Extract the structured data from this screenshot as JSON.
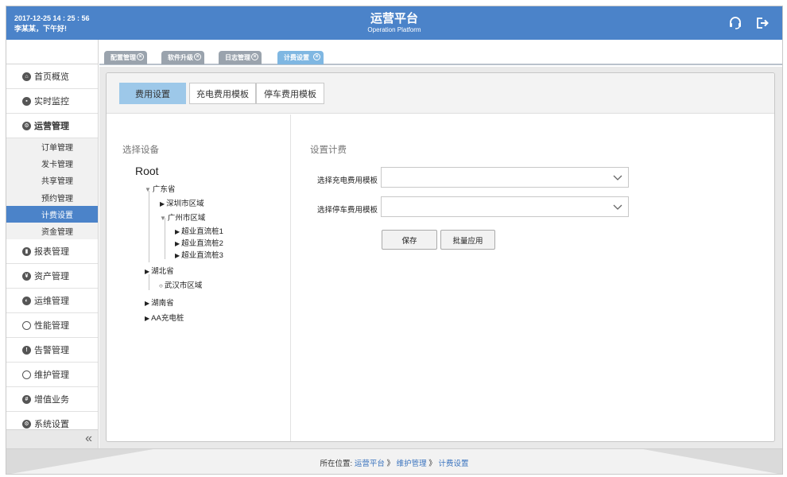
{
  "header": {
    "datetime": "2017-12-25 14 : 25 : 56",
    "greeting": "李某某，下午好!",
    "title": "运营平台",
    "subtitle": "Operation Platform",
    "icons": [
      "headset-icon",
      "logout-icon"
    ]
  },
  "sidebar": {
    "items": [
      {
        "label": "首页概览",
        "icon": "home-icon"
      },
      {
        "label": "实时监控",
        "icon": "monitor-icon"
      },
      {
        "label": "运营管理",
        "icon": "settings-icon"
      },
      {
        "label": "报表管理",
        "icon": "report-icon"
      },
      {
        "label": "资产管理",
        "icon": "asset-icon"
      },
      {
        "label": "运维管理",
        "icon": "ops-icon"
      },
      {
        "label": "性能管理",
        "icon": "gauge-icon"
      },
      {
        "label": "告警管理",
        "icon": "alert-icon"
      },
      {
        "label": "维护管理",
        "icon": "maintenance-icon"
      },
      {
        "label": "增值业务",
        "icon": "value-added-icon"
      },
      {
        "label": "系统设置",
        "icon": "system-icon"
      }
    ],
    "subitems": [
      "订单管理",
      "发卡管理",
      "共享管理",
      "预约管理",
      "计费设置",
      "资金管理"
    ],
    "collapse_label": "«"
  },
  "tabs": [
    "配置管理",
    "软件升级",
    "日志管理",
    "计费设置"
  ],
  "panel": {
    "buttons": [
      "费用设置",
      "充电费用模板",
      "停车费用模板"
    ],
    "left_title": "选择设备",
    "tree": {
      "root": "Root",
      "nodes": [
        "广东省",
        "深圳市区域",
        "广州市区域",
        "超业直流桩1",
        "超业直流桩2",
        "超业直流桩3",
        "湖北省",
        "武汉市区域",
        "湖南省",
        "AA充电桩"
      ]
    },
    "right_title": "设置计费",
    "form": {
      "charge_label": "选择充电费用模板",
      "charge_value": "",
      "parking_label": "选择停车费用模板",
      "parking_value": "",
      "save": "保存",
      "batch_apply": "批量应用"
    }
  },
  "footer": {
    "prefix": "所在位置:",
    "crumbs": [
      "运营平台",
      "维护管理",
      "计费设置"
    ],
    "separator": "》"
  },
  "colors": {
    "header_blue": "#4b83c9",
    "active_tab": "#7fb7e2",
    "active_button": "#9dc8e9",
    "link_blue": "#3b74bf"
  }
}
